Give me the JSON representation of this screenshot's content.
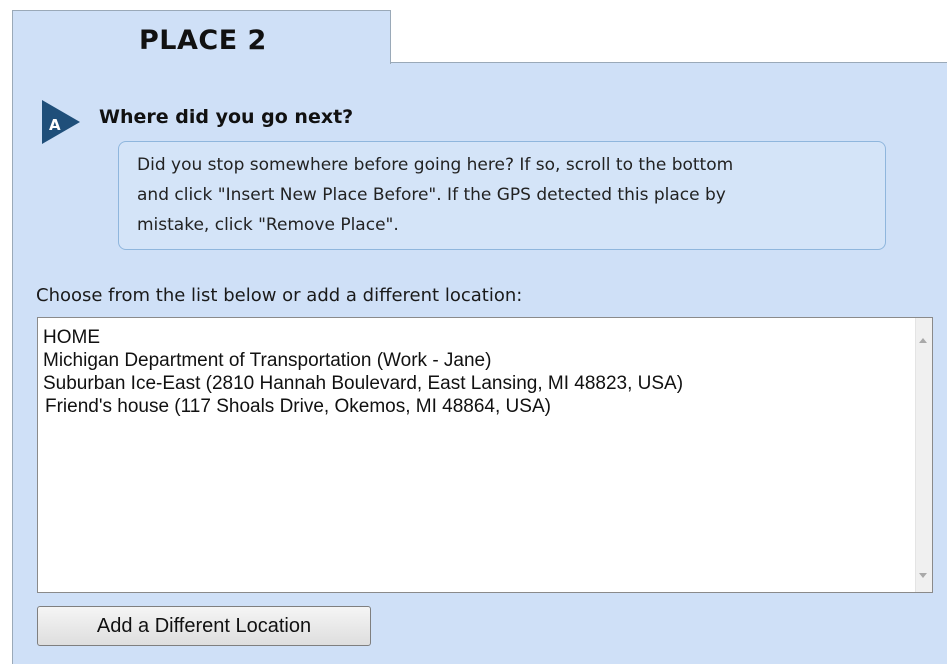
{
  "tab": {
    "title": "PLACE 2"
  },
  "question": {
    "badge_letter": "A",
    "badge_color": "#1f4f7a",
    "text": "Where did you go next?"
  },
  "help": {
    "lines": [
      "Did you stop somewhere before going here? If so, scroll to the bottom",
      "and click \"Insert New Place Before\". If the GPS detected this place by",
      "mistake, click \"Remove Place\"."
    ]
  },
  "choose_label": "Choose from the list below or add a different location:",
  "locations": [
    "HOME",
    "Michigan Department of Transportation (Work - Jane)",
    "Suburban Ice-East (2810 Hannah Boulevard, East Lansing, MI 48823, USA)",
    "Friend's house (117 Shoals Drive, Okemos, MI 48864, USA)"
  ],
  "add_button_label": "Add a Different Location",
  "colors": {
    "panel_background": "#cfe0f7",
    "help_border": "#8fb6dd"
  },
  "icons": {
    "badge": "play-triangle-badge-icon",
    "scroll_up": "scroll-up-arrow-icon",
    "scroll_down": "scroll-down-arrow-icon"
  }
}
